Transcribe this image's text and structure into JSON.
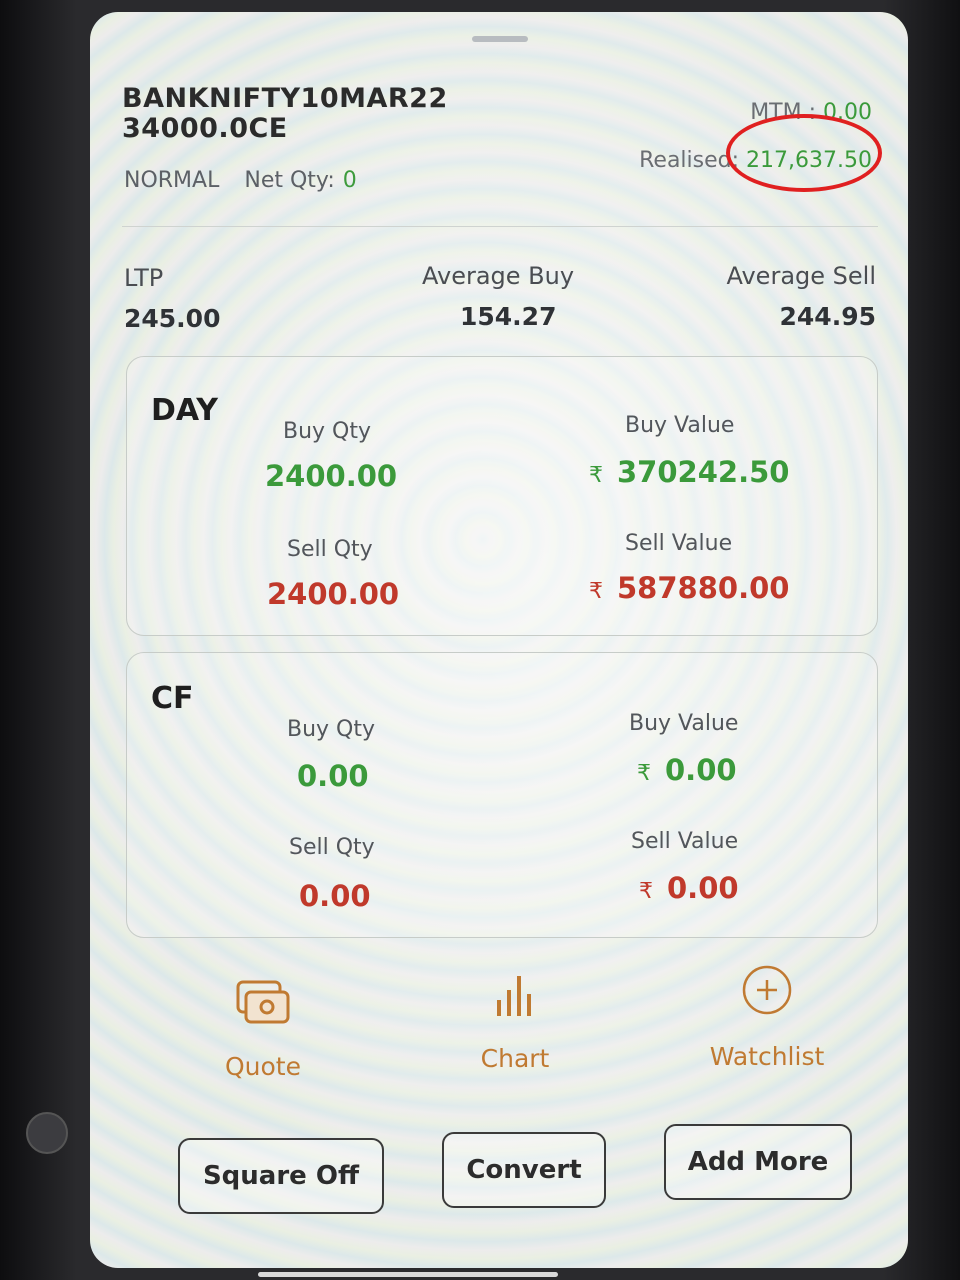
{
  "header": {
    "symbol_line1": "BANKNIFTY10MAR22",
    "symbol_line2": "34000.0CE",
    "product": "NORMAL",
    "net_qty_label": "Net Qty:",
    "net_qty_value": "0",
    "mtm_label": "MTM :",
    "mtm_value": "0.00",
    "realised_label": "Realised:",
    "realised_value": "217,637.50"
  },
  "stats": {
    "ltp_label": "LTP",
    "ltp_value": "245.00",
    "avg_buy_label": "Average Buy",
    "avg_buy_value": "154.27",
    "avg_sell_label": "Average Sell",
    "avg_sell_value": "244.95"
  },
  "day": {
    "title": "DAY",
    "buy_qty_label": "Buy Qty",
    "buy_qty_value": "2400.00",
    "buy_value_label": "Buy Value",
    "buy_value_currency": "₹",
    "buy_value_value": "370242.50",
    "sell_qty_label": "Sell Qty",
    "sell_qty_value": "2400.00",
    "sell_value_label": "Sell Value",
    "sell_value_currency": "₹",
    "sell_value_value": "587880.00"
  },
  "cf": {
    "title": "CF",
    "buy_qty_label": "Buy Qty",
    "buy_qty_value": "0.00",
    "buy_value_label": "Buy Value",
    "buy_value_currency": "₹",
    "buy_value_value": "0.00",
    "sell_qty_label": "Sell Qty",
    "sell_qty_value": "0.00",
    "sell_value_label": "Sell Value",
    "sell_value_currency": "₹",
    "sell_value_value": "0.00"
  },
  "actions": [
    {
      "label": "Quote",
      "icon": "quote-icon"
    },
    {
      "label": "Chart",
      "icon": "chart-icon"
    },
    {
      "label": "Watchlist",
      "icon": "add-circle-icon"
    }
  ],
  "buttons": {
    "square_off": "Square Off",
    "convert": "Convert",
    "add_more": "Add More"
  },
  "colors": {
    "positive": "#3b9a3b",
    "negative": "#c0392b",
    "accent": "#c07a32",
    "annotation": "#e02020"
  }
}
